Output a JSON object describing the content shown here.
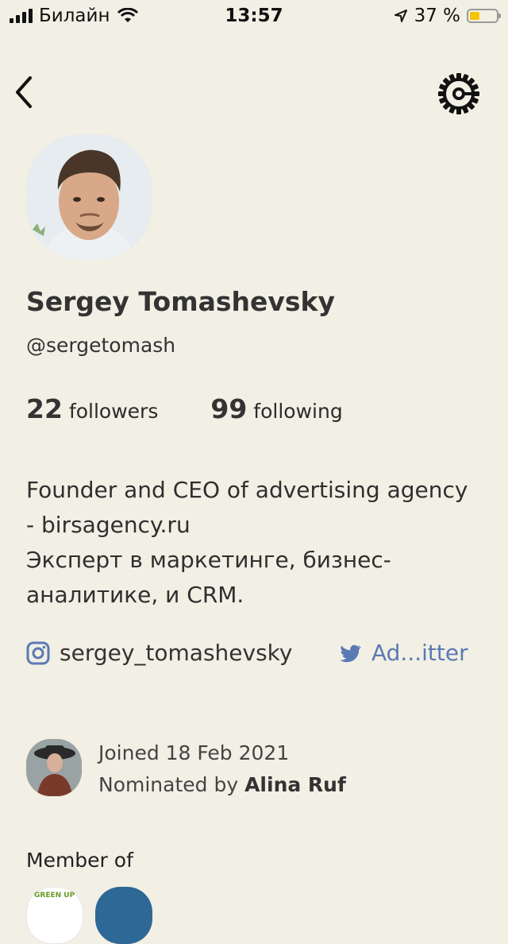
{
  "status": {
    "carrier": "Билайн",
    "time": "13:57",
    "battery": "37 %",
    "battery_level": 0.37
  },
  "nav": {
    "back_icon": "chevron-left-icon",
    "settings_icon": "gear-icon"
  },
  "profile": {
    "name": "Sergey Tomashevsky",
    "handle": "@sergetomash",
    "followers_count": "22",
    "followers_label": "followers",
    "following_count": "99",
    "following_label": "following",
    "bio_lines": [
      "Founder and CEO of advertising agency",
      "- birsagency.ru",
      "Эксперт в маркетинге, бизнес-",
      "аналитике, и CRM."
    ],
    "instagram": "sergey_tomashevsky",
    "twitter": "Ad...itter"
  },
  "joined": {
    "date_text": "Joined 18 Feb 2021",
    "nominated_prefix": "Nominated by",
    "nominated_by": "Alina Ruf"
  },
  "member_of": {
    "title": "Member of",
    "club1_label": "GREEN UP"
  },
  "colors": {
    "background": "#f2efe4",
    "link": "#5a7ab4",
    "battery": "#f5c400"
  }
}
